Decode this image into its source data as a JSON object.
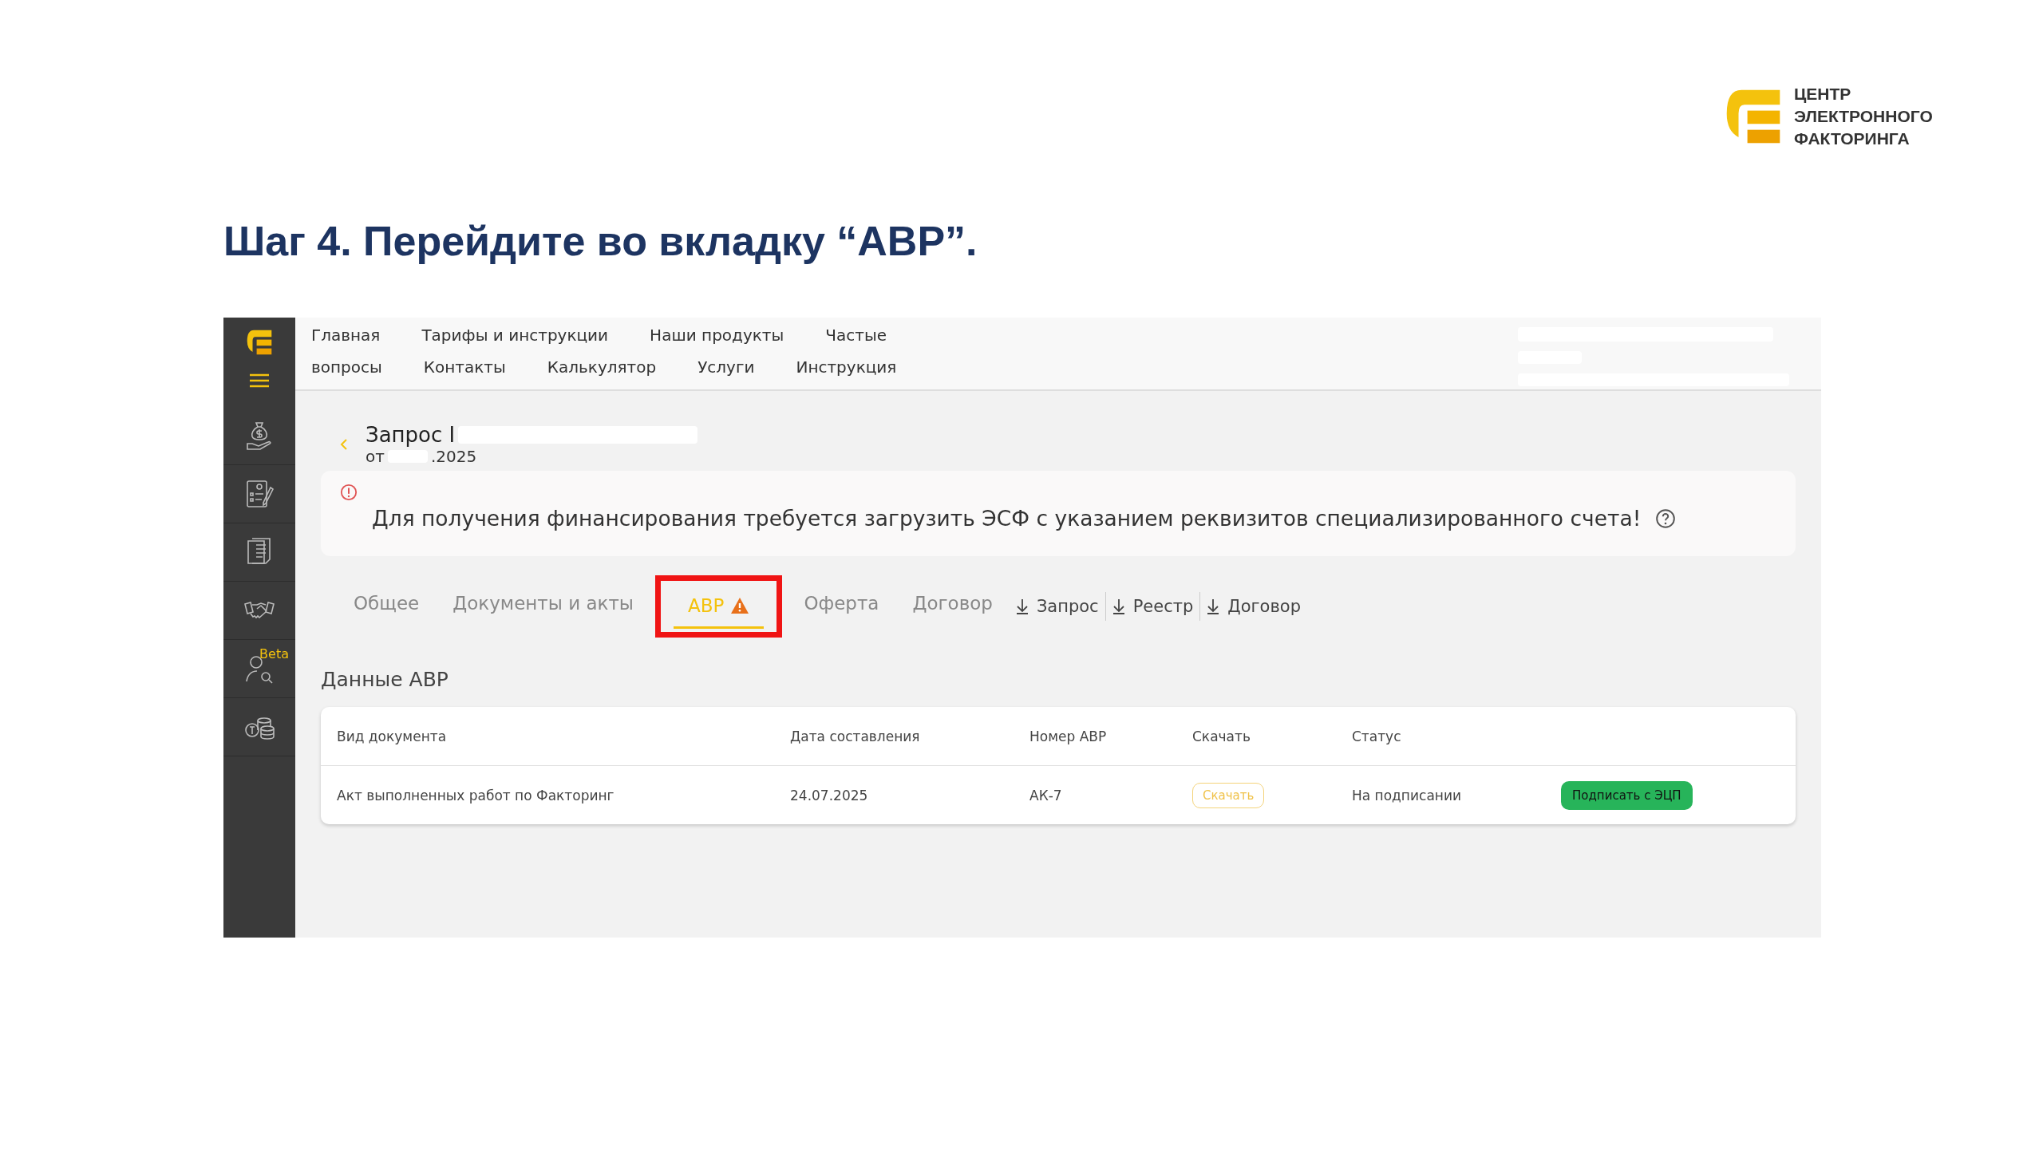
{
  "brand": {
    "lines": [
      "ЦЕНТР",
      "ЭЛЕКТРОННОГО",
      "ФАКТОРИНГА"
    ]
  },
  "heading": "Шаг 4. Перейдите во вкладку “АВР”.",
  "app": {
    "sidebar": {
      "badge": "Beta"
    },
    "nav": {
      "row_1": [
        "Главная",
        "Тарифы и инструкции",
        "Наши продукты",
        "Частые"
      ],
      "row_2": [
        "вопросы",
        "Контакты",
        "Калькулятор",
        "Услуги",
        "Инструкция"
      ]
    },
    "request": {
      "title": "Запрос I",
      "date_prefix": "от",
      "date_suffix": ".2025"
    },
    "alert": {
      "text": "Для получения финансирования требуется загрузить ЭСФ с указанием реквизитов специализированного счета!"
    },
    "tabs": [
      {
        "label": "Общее",
        "selected": false,
        "warning": false,
        "highlighted": false
      },
      {
        "label": "Документы и акты",
        "selected": false,
        "warning": false,
        "highlighted": false
      },
      {
        "label": "АВР",
        "selected": true,
        "warning": true,
        "highlighted": true
      },
      {
        "label": "Оферта",
        "selected": false,
        "warning": false,
        "highlighted": false
      },
      {
        "label": "Договор",
        "selected": false,
        "warning": false,
        "highlighted": false
      }
    ],
    "downloads": [
      "Запрос",
      "Реестр",
      "Договор"
    ],
    "section_title": "Данные АВР",
    "table": {
      "columns": [
        "Вид документа",
        "Дата составления",
        "Номер АВР",
        "Скачать",
        "Статус"
      ],
      "rows": [
        {
          "document_type": "Акт выполненных работ по Факторинг",
          "date": "24.07.2025",
          "number": "АК-7",
          "download": "Скачать",
          "status": "На подписании",
          "action": "Подписать с ЭЦП"
        }
      ]
    }
  }
}
